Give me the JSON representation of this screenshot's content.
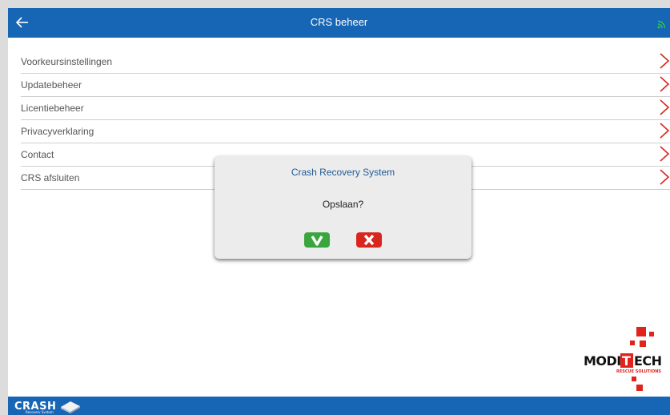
{
  "header": {
    "title": "CRS beheer",
    "back_icon": "arrow-left-icon",
    "status_icon": "wifi-connected-icon",
    "status_color": "#2fd13a"
  },
  "menu": {
    "items": [
      {
        "label": "Voorkeursinstellingen"
      },
      {
        "label": "Updatebeheer"
      },
      {
        "label": "Licentiebeheer"
      },
      {
        "label": "Privacyverklaring"
      },
      {
        "label": "Contact"
      },
      {
        "label": "CRS afsluiten"
      }
    ],
    "chevron_color": "#d8261d"
  },
  "dialog": {
    "title": "Crash Recovery System",
    "message": "Opslaan?",
    "confirm_icon": "check-icon",
    "cancel_icon": "x-icon"
  },
  "branding": {
    "right_logo": "MODITECH",
    "right_logo_tagline": "RESCUE SOLUTIONS",
    "footer_logo": "CRASH",
    "footer_logo_sub": "Recovery System"
  },
  "colors": {
    "primary": "#1766b5",
    "confirm": "#3aa53d",
    "cancel": "#d8261d"
  }
}
